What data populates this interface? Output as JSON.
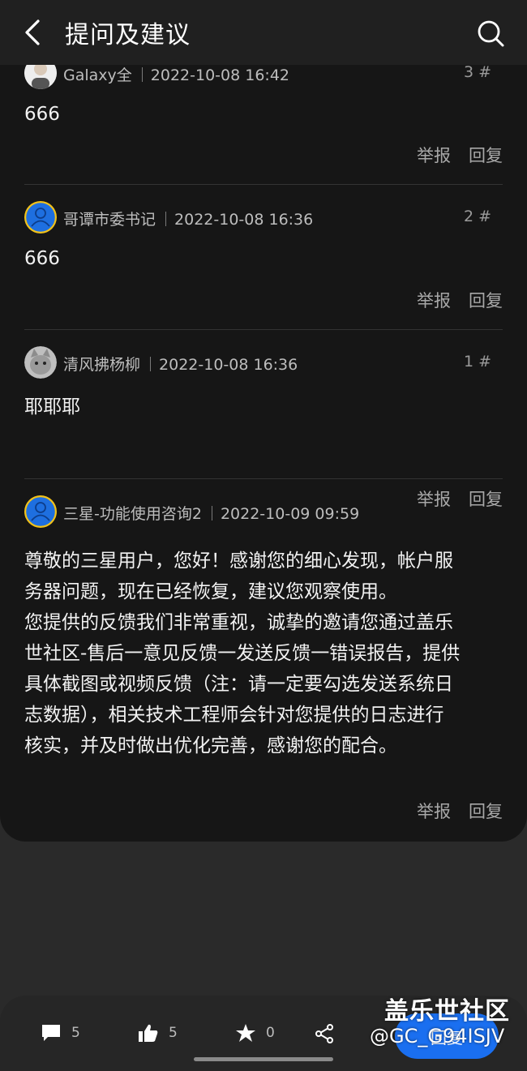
{
  "header": {
    "title": "提问及建议"
  },
  "posts": [
    {
      "username": "Galaxy全",
      "time": "2022-10-08 16:42",
      "floor": "3 #",
      "content": "666",
      "report": "举报",
      "reply": "回复"
    },
    {
      "username": "哥谭市委书记",
      "time": "2022-10-08 16:36",
      "floor": "2 #",
      "content": "666",
      "report": "举报",
      "reply": "回复"
    },
    {
      "username": "清风拂杨柳",
      "time": "2022-10-08 16:36",
      "floor": "1 #",
      "content": "耶耶耶",
      "report": "举报",
      "reply": "回复"
    },
    {
      "username": "三星-功能使用咨询2",
      "time": "2022-10-09 09:59",
      "floor": "",
      "content_lines": [
        "尊敬的三星用户，您好！感谢您的细心发现，帐户服",
        "务器问题，现在已经恢复，建议您观察使用。",
        "您提供的反馈我们非常重视，诚挚的邀请您通过盖乐",
        "世社区-售后一意见反馈一发送反馈一错误报告，提供",
        "具体截图或视频反馈（注：请一定要勾选发送系统日",
        "志数据），相关技术工程师会针对您提供的日志进行",
        "核实，并及时做出优化完善，感谢您的配合。"
      ],
      "report": "举报",
      "reply": "回复"
    }
  ],
  "bottom_bar": {
    "comments_count": "5",
    "likes_count": "5",
    "favorites_count": "0",
    "reply_label": "回复"
  },
  "watermark": {
    "brand": "盖乐世社区",
    "handle": "@GC_G94ISJV"
  },
  "colors": {
    "accent": "#1a6ff0",
    "avatar_blue": "#1e6fe0",
    "avatar_ring": "#f2c21a"
  }
}
